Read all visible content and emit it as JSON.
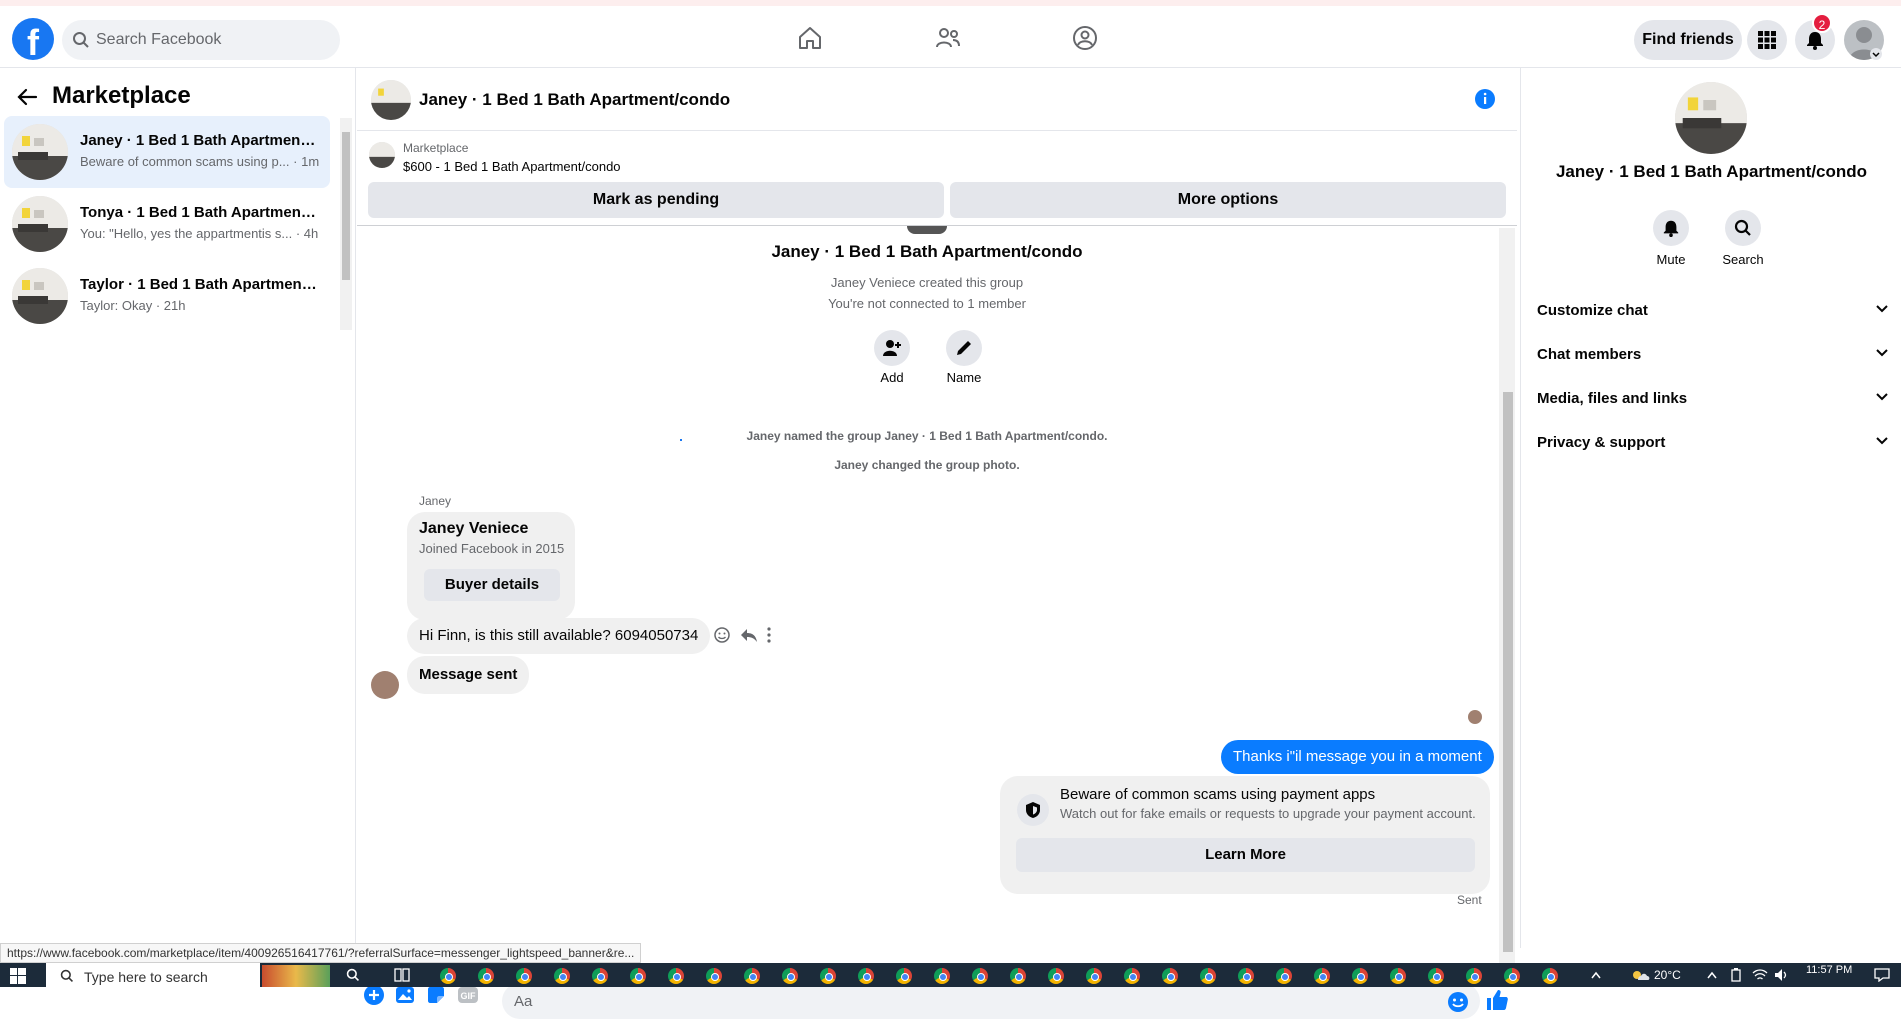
{
  "top_bar": {
    "logo": "facebook-logo",
    "search_placeholder": "Search Facebook",
    "nav_icons": [
      "home-icon",
      "friends-icon",
      "groups-icon"
    ],
    "find_friends_label": "Find friends",
    "notifications_count": "2"
  },
  "left_panel": {
    "title": "Marketplace",
    "conversations": [
      {
        "name": "Janey · 1 Bed 1 Bath Apartment/...",
        "preview": "Beware of common scams using p... · 1m"
      },
      {
        "name": "Tonya · 1 Bed 1 Bath Apartment/...",
        "preview": "You: \"Hello, yes the appartmentis s... · 4h"
      },
      {
        "name": "Taylor · 1 Bed 1 Bath Apartment/...",
        "preview": "Taylor: Okay · 21h"
      }
    ]
  },
  "chat": {
    "header_title": "Janey · 1 Bed 1 Bath Apartment/condo",
    "marketplace_label": "Marketplace",
    "listing": "$600 - 1 Bed 1 Bath Apartment/condo",
    "mark_pending_label": "Mark as pending",
    "more_options_label": "More options",
    "group_title": "Janey · 1 Bed 1 Bath Apartment/condo",
    "created_by": "Janey Veniece created this group",
    "not_connected": "You're not connected to 1 member",
    "add_label": "Add",
    "name_label": "Name",
    "sys_named": "Janey named the group Janey · 1 Bed 1 Bath Apartment/condo.",
    "sys_photo": "Janey changed the group photo.",
    "sender": "Janey",
    "card_name": "Janey Veniece",
    "card_joined": "Joined Facebook in 2015",
    "buyer_details_label": "Buyer details",
    "msg_incoming": "Hi Finn, is this still available? 6094050734",
    "msg_sent_notice": "Message sent",
    "msg_outgoing": "Thanks i\"il message you in a moment",
    "warning_title": "Beware of common scams using payment apps",
    "warning_sub": "Watch out for fake emails or requests to upgrade your payment account.",
    "learn_more_label": "Learn More",
    "sent_status": "Sent",
    "compose_placeholder": "Aa"
  },
  "right_panel": {
    "title": "Janey · 1 Bed 1 Bath Apartment/condo",
    "mute_label": "Mute",
    "search_label": "Search",
    "sections": [
      "Customize chat",
      "Chat members",
      "Media, files and links",
      "Privacy & support"
    ]
  },
  "status_url": "https://www.facebook.com/marketplace/item/400926516417761/?referralSurface=messenger_lightspeed_banner&re...",
  "taskbar": {
    "search_placeholder": "Type here to search",
    "temperature": "20°C",
    "time": "11:57 PM"
  },
  "colors": {
    "brand_blue": "#1877f2",
    "message_blue": "#0a7cff",
    "active_conversation": "#e7f0fc",
    "badge_red": "#e41e3f"
  }
}
